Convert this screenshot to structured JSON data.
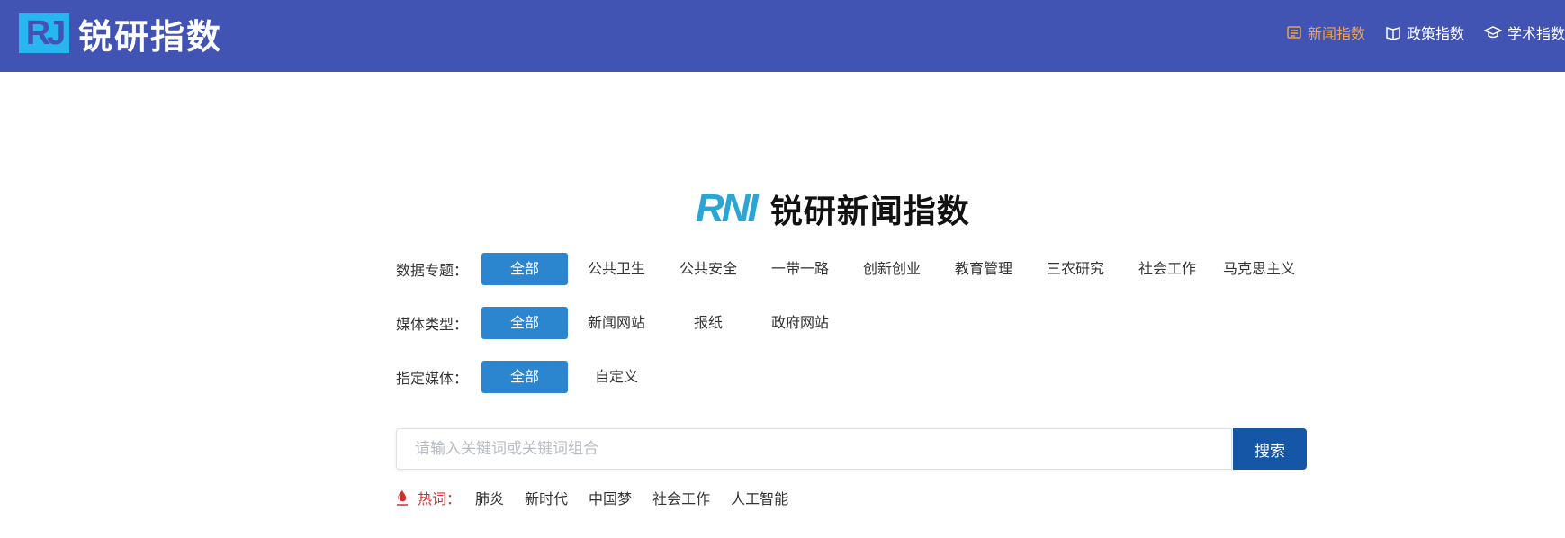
{
  "header": {
    "logo_mark": "RJ",
    "logo_text": "锐研指数",
    "nav": [
      {
        "label": "新闻指数",
        "icon": "news-icon",
        "active": true
      },
      {
        "label": "政策指数",
        "icon": "policy-book-icon",
        "active": false
      },
      {
        "label": "学术指数",
        "icon": "graduation-cap-icon",
        "active": false
      }
    ],
    "colors": {
      "bar": "#4254b3",
      "active": "#f0a14a",
      "logo": "#27b6f0"
    }
  },
  "brand": {
    "mark": "RNI",
    "title": "锐研新闻指数"
  },
  "filters": {
    "topics": {
      "label": "数据专题：",
      "options": [
        "全部",
        "公共卫生",
        "公共安全",
        "一带一路",
        "创新创业",
        "教育管理",
        "三农研究",
        "社会工作",
        "马克思主义"
      ],
      "selected": "全部"
    },
    "media_type": {
      "label": "媒体类型：",
      "options": [
        "全部",
        "新闻网站",
        "报纸",
        "政府网站"
      ],
      "selected": "全部"
    },
    "media": {
      "label": "指定媒体：",
      "options": [
        "全部",
        "自定义"
      ],
      "selected": "全部"
    }
  },
  "search": {
    "placeholder": "请输入关键词或关键词组合",
    "value": "",
    "button": "搜索"
  },
  "hot": {
    "label": "热词：",
    "icon": "flame-icon",
    "items": [
      "肺炎",
      "新时代",
      "中国梦",
      "社会工作",
      "人工智能"
    ]
  }
}
